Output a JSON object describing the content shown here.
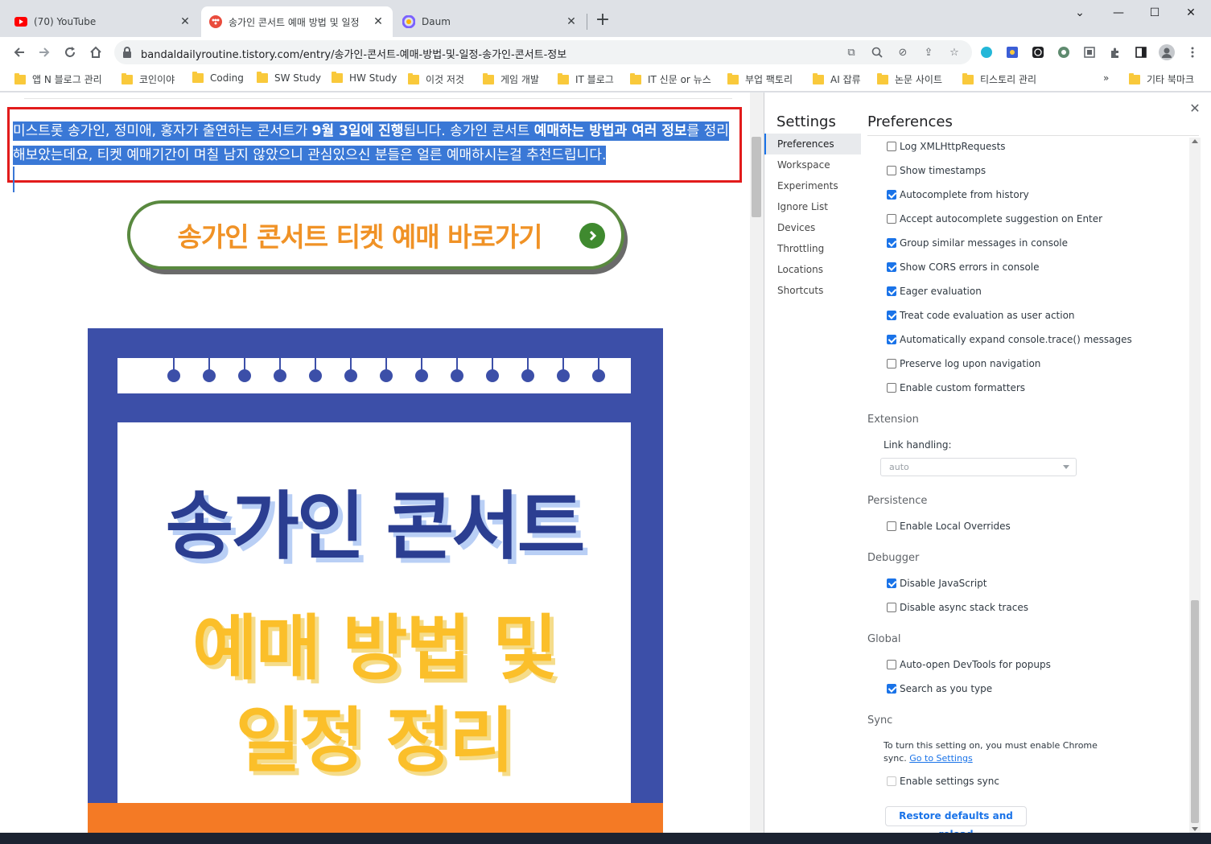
{
  "tabs": [
    {
      "title": "(70) YouTube",
      "icon": "youtube-icon"
    },
    {
      "title": "송가인 콘서트 예매 방법 및 일정",
      "icon": "tistory-icon"
    },
    {
      "title": "Daum",
      "icon": "daum-icon"
    }
  ],
  "url": "bandaldailyroutine.tistory.com/entry/송가인-콘서트-예매-방법-및-일정-송가인-콘서트-정보",
  "bookmarks": [
    "앱 N 블로그 관리",
    "코인이야",
    "Coding",
    "SW Study",
    "HW Study",
    "이것 저것",
    "게임 개발",
    "IT 블로그",
    "IT 신문 or 뉴스",
    "부업 팩토리",
    "AI 잡류",
    "논문 사이트",
    "티스토리 관리"
  ],
  "bookmarks_more": "»",
  "bookmarks_other": "기타 북마크",
  "article": {
    "line1_pre": "미스트롯 송가인, 정미애, 홍자가 출연하는 콘서트가 ",
    "line1_bold1": "9월 3일에 진행",
    "line1_mid": "됩니다. 송가인 콘서트 ",
    "line1_bold2": "예매하는 방법과 여러 정보",
    "line1_post": "를 정리",
    "line2": "해보았는데요, 티켓 예매기간이 며칠 남지 않았으니 관심있으신 분들은 얼른 예매하시는걸 추천드립니다.",
    "ticket_button": "송가인 콘서트 티켓 예매 바로가기",
    "poster_title": "송가인 콘서트",
    "poster_sub1": "예매 방법 및",
    "poster_sub2": "일정 정리"
  },
  "devtools": {
    "settings_title": "Settings",
    "nav": [
      "Preferences",
      "Workspace",
      "Experiments",
      "Ignore List",
      "Devices",
      "Throttling",
      "Locations",
      "Shortcuts"
    ],
    "preferences_title": "Preferences",
    "console_options": [
      {
        "label": "Log XMLHttpRequests",
        "checked": false
      },
      {
        "label": "Show timestamps",
        "checked": false
      },
      {
        "label": "Autocomplete from history",
        "checked": true
      },
      {
        "label": "Accept autocomplete suggestion on Enter",
        "checked": false
      },
      {
        "label": "Group similar messages in console",
        "checked": true
      },
      {
        "label": "Show CORS errors in console",
        "checked": true
      },
      {
        "label": "Eager evaluation",
        "checked": true
      },
      {
        "label": "Treat code evaluation as user action",
        "checked": true
      },
      {
        "label": "Automatically expand console.trace() messages",
        "checked": true
      },
      {
        "label": "Preserve log upon navigation",
        "checked": false
      },
      {
        "label": "Enable custom formatters",
        "checked": false
      }
    ],
    "extension": {
      "title": "Extension",
      "link_handling_label": "Link handling:",
      "link_handling_value": "auto"
    },
    "persistence": {
      "title": "Persistence",
      "enable_local_overrides": "Enable Local Overrides"
    },
    "debugger": {
      "title": "Debugger",
      "disable_js": "Disable JavaScript",
      "disable_async": "Disable async stack traces"
    },
    "global": {
      "title": "Global",
      "auto_open": "Auto-open DevTools for popups",
      "search_as_type": "Search as you type"
    },
    "sync": {
      "title": "Sync",
      "note": "To turn this setting on, you must enable Chrome sync.",
      "link": "Go to Settings",
      "enable_sync": "Enable settings sync"
    },
    "restore_button": "Restore defaults and reload"
  }
}
